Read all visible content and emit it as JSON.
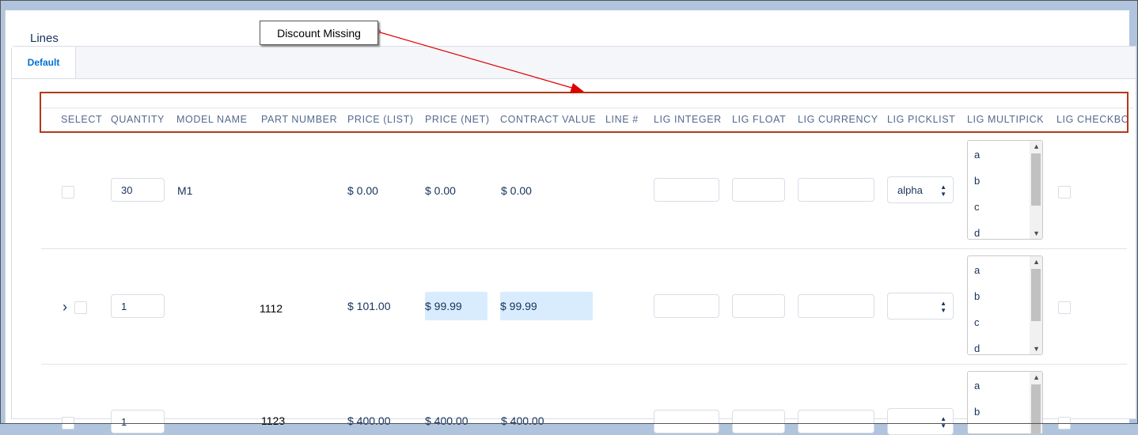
{
  "section": {
    "title": "Lines"
  },
  "tabs": [
    {
      "label": "Default"
    }
  ],
  "callout": {
    "text": "Discount Missing"
  },
  "columns": [
    "SELECT",
    "QUANTITY",
    "MODEL NAME",
    "PART NUMBER",
    "PRICE (LIST)",
    "PRICE (NET)",
    "CONTRACT VALUE",
    "LINE #",
    "LIG INTEGER",
    "LIG FLOAT",
    "LIG CURRENCY",
    "LIG PICKLIST",
    "LIG MULTIPICK",
    "LIG CHECKBO"
  ],
  "rows": [
    {
      "quantity": "30",
      "model_name": "M1",
      "part_number": "",
      "price_list": "$ 0.00",
      "price_net": "$ 0.00",
      "contract_value": "$ 0.00",
      "picklist": "alpha",
      "multipick_options": [
        "a",
        "b",
        "c",
        "d"
      ]
    },
    {
      "quantity": "1",
      "model_name": "",
      "part_number": "1112",
      "price_list": "$ 101.00",
      "price_net": "$ 99.99",
      "contract_value": "$ 99.99",
      "picklist": "",
      "multipick_options": [
        "a",
        "b",
        "c",
        "d"
      ]
    },
    {
      "quantity": "1",
      "model_name": "",
      "part_number": "1123",
      "price_list": "$ 400.00",
      "price_net": "$ 400.00",
      "contract_value": "$ 400.00",
      "picklist": "",
      "multipick_options": [
        "a",
        "b"
      ]
    }
  ],
  "icons": {
    "expand": "chevron-right-icon",
    "spin": "up-down-arrows-icon"
  },
  "colors": {
    "highlight_border": "#b23a17",
    "arrow": "#e00000",
    "net_price_bg": "#d8ecfd",
    "tab_active": "#0070d2"
  }
}
